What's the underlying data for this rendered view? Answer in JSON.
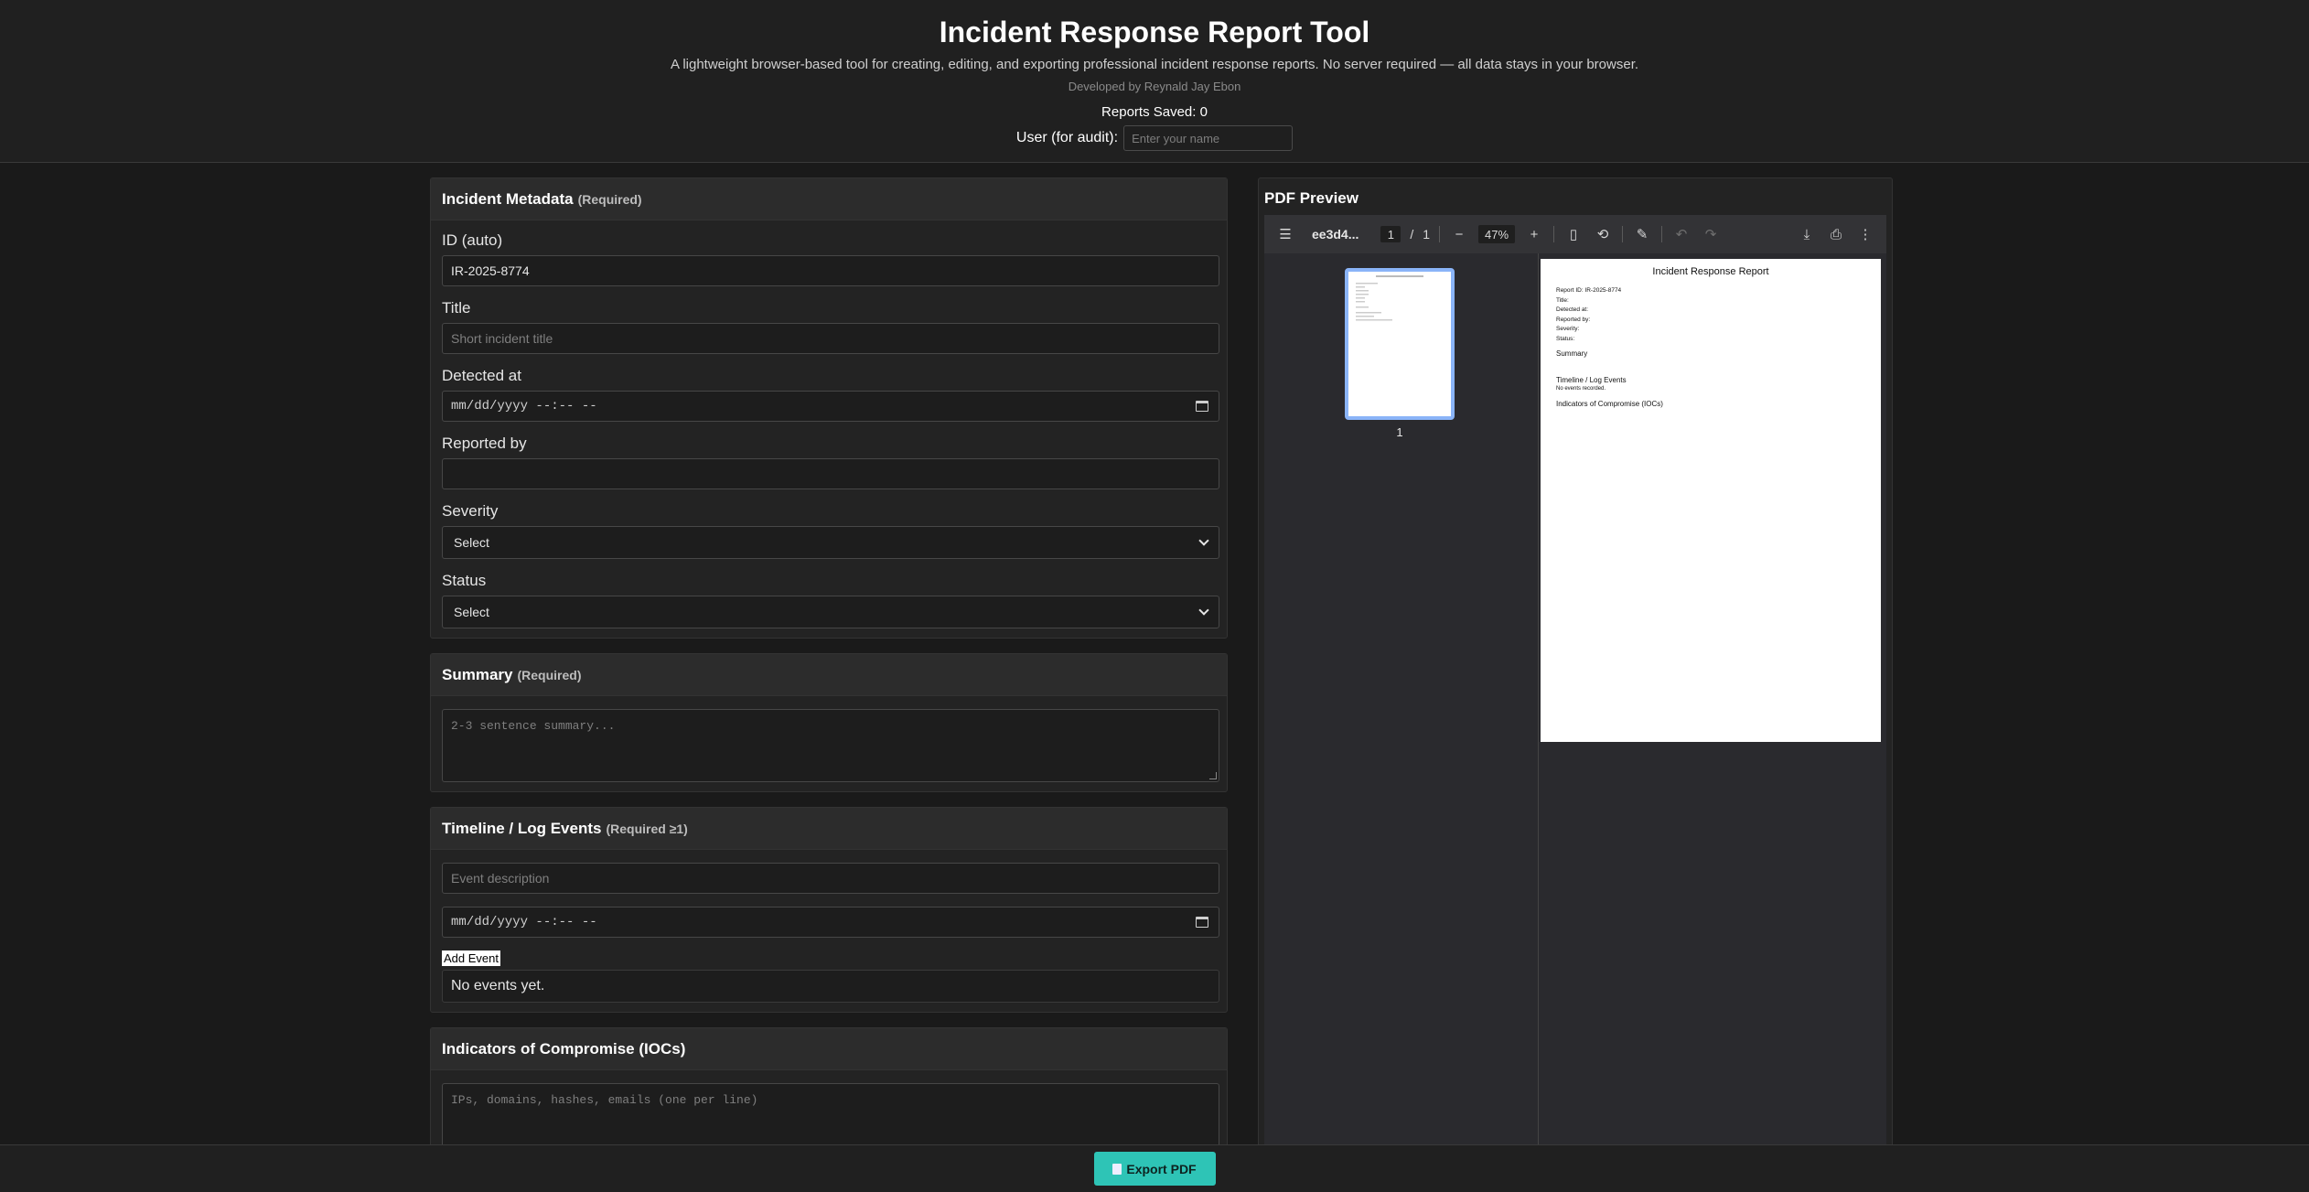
{
  "header": {
    "title": "Incident Response Report Tool",
    "subtitle": "A lightweight browser-based tool for creating, editing, and exporting professional incident response reports. No server required — all data stays in your browser.",
    "developer": "Developed by Reynald Jay Ebon",
    "reports_saved": "Reports Saved: 0",
    "user_label": "User (for audit):",
    "user_placeholder": "Enter your name"
  },
  "metadata": {
    "heading": "Incident Metadata",
    "required": "(Required)",
    "id_label": "ID (auto)",
    "id_value": "IR-2025-8774",
    "title_label": "Title",
    "title_placeholder": "Short incident title",
    "detected_label": "Detected at",
    "detected_value": "mm/dd/yyyy --:-- --",
    "reported_label": "Reported by",
    "reported_value": "",
    "severity_label": "Severity",
    "severity_value": "Select",
    "status_label": "Status",
    "status_value": "Select"
  },
  "summary": {
    "heading": "Summary",
    "required": "(Required)",
    "placeholder": "2-3 sentence summary..."
  },
  "timeline": {
    "heading": "Timeline / Log Events",
    "required": "(Required ≥1)",
    "event_placeholder": "Event description",
    "date_value": "mm/dd/yyyy --:-- --",
    "add_label": "Add Event",
    "empty_text": "No events yet."
  },
  "iocs": {
    "heading": "Indicators of Compromise (IOCs)",
    "placeholder": "IPs, domains, hashes, emails (one per line)"
  },
  "preview": {
    "heading": "PDF Preview",
    "filename": "ee3d4...",
    "page_current": "1",
    "page_sep": "/",
    "page_total": "1",
    "zoom": "47%",
    "thumb_label": "1",
    "icons": [
      "menu-icon",
      "zoom-out-icon",
      "zoom-in-icon",
      "fit-page-icon",
      "rotate-icon",
      "draw-icon",
      "undo-icon",
      "redo-icon",
      "download-icon",
      "print-icon",
      "more-icon"
    ],
    "doc": {
      "title": "Incident Response Report",
      "report_id": "Report ID: IR-2025-8774",
      "title_line": "Title:",
      "detected_line": "Detected at:",
      "reported_line": "Reported by:",
      "severity_line": "Severity:",
      "status_line": "Status:",
      "summary_heading": "Summary",
      "timeline_heading": "Timeline / Log Events",
      "no_events": "No events recorded.",
      "ioc_heading": "Indicators of Compromise (IOCs)"
    }
  },
  "footer": {
    "export_label": "Export PDF"
  }
}
